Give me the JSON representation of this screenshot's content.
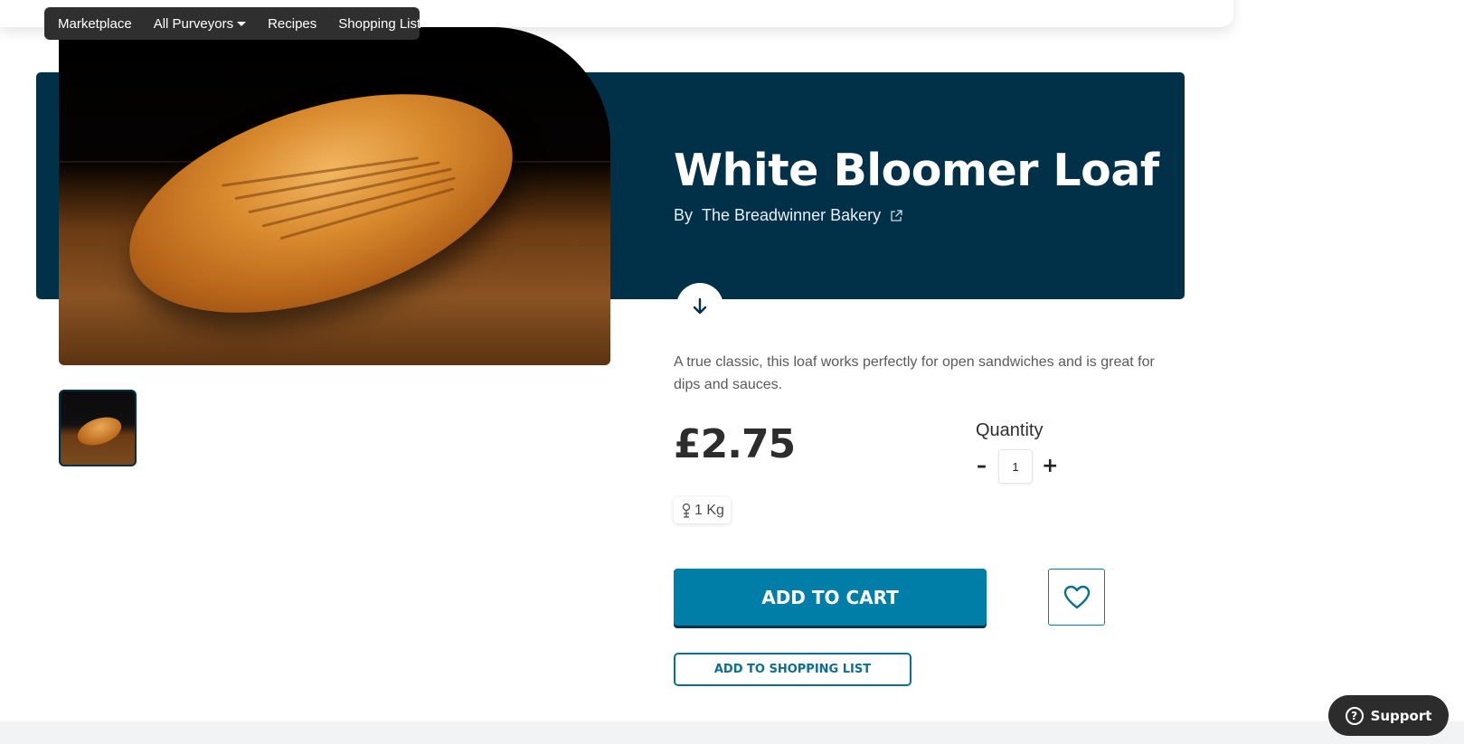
{
  "nav": {
    "items": [
      {
        "label": "Marketplace"
      },
      {
        "label": "All Purveyors"
      },
      {
        "label": "Recipes"
      },
      {
        "label": "Shopping List"
      }
    ]
  },
  "product": {
    "title": "White Bloomer Loaf",
    "by_label": "By",
    "vendor": "The Breadwinner Bakery",
    "description": "A true classic, this loaf works perfectly for open sandwiches and is great for dips and sauces.",
    "price": "£2.75",
    "weight": "1 Kg"
  },
  "quantity": {
    "label": "Quantity",
    "value": "1",
    "minus": "–",
    "plus": "+"
  },
  "actions": {
    "add_to_cart": "ADD TO CART",
    "add_to_shopping_list": "ADD TO SHOPPING LIST"
  },
  "support": {
    "label": "Support"
  },
  "colors": {
    "hero_bg": "#003149",
    "primary": "#007ea7",
    "nav_bg": "#2f2f2f"
  }
}
